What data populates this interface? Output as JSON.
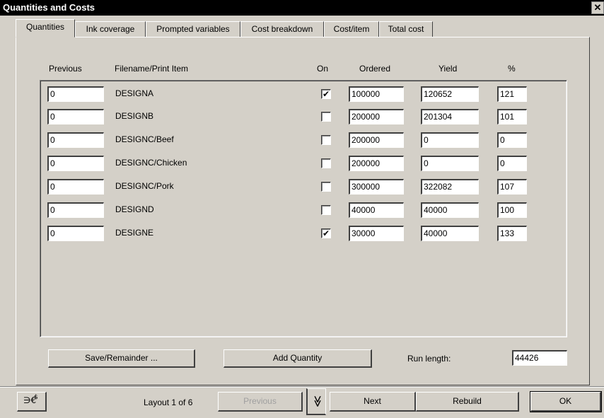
{
  "window": {
    "title": "Quantities and Costs",
    "close_glyph": "✕"
  },
  "tabs": [
    {
      "label": "Quantities",
      "active": true
    },
    {
      "label": "Ink coverage"
    },
    {
      "label": "Prompted variables"
    },
    {
      "label": "Cost breakdown"
    },
    {
      "label": "Cost/item"
    },
    {
      "label": "Total cost"
    }
  ],
  "columns": {
    "previous": "Previous",
    "filename": "Filename/Print Item",
    "on": "On",
    "ordered": "Ordered",
    "yield": "Yield",
    "percent": "%"
  },
  "rows": [
    {
      "previous": "0",
      "name": "DESIGNA",
      "on": "✔",
      "ordered": "100000",
      "yield": "120652",
      "percent": "121"
    },
    {
      "previous": "0",
      "name": "DESIGNB",
      "on": "",
      "ordered": "200000",
      "yield": "201304",
      "percent": "101"
    },
    {
      "previous": "0",
      "name": "DESIGNC/Beef",
      "on": "",
      "ordered": "200000",
      "yield": "0",
      "percent": "0"
    },
    {
      "previous": "0",
      "name": "DESIGNC/Chicken",
      "on": "",
      "ordered": "200000",
      "yield": "0",
      "percent": "0"
    },
    {
      "previous": "0",
      "name": "DESIGNC/Pork",
      "on": "",
      "ordered": "300000",
      "yield": "322082",
      "percent": "107"
    },
    {
      "previous": "0",
      "name": "DESIGND",
      "on": "",
      "ordered": "40000",
      "yield": "40000",
      "percent": "100"
    },
    {
      "previous": "0",
      "name": "DESIGNE",
      "on": "✔",
      "ordered": "30000",
      "yield": "40000",
      "percent": "133"
    }
  ],
  "actions": {
    "save_remainder": "Save/Remainder ...",
    "add_quantity": "Add Quantity",
    "run_length_label": "Run length:",
    "run_length_value": "44426"
  },
  "footer": {
    "layout_status": "Layout 1 of 6",
    "previous": "Previous",
    "chevron": "≫",
    "next": "Next",
    "rebuild": "Rebuild",
    "ok": "OK",
    "app_icon": "currency-calc-icon"
  }
}
